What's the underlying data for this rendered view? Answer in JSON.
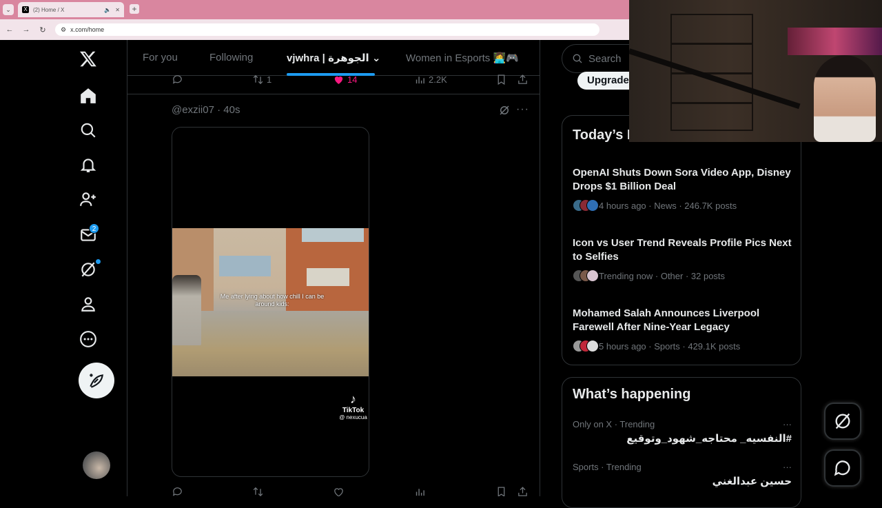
{
  "browser": {
    "tab_title": "(2) Home / X",
    "tab_favicon": "X",
    "url": "x.com/home"
  },
  "nav": {
    "messages_badge": "2"
  },
  "timeline": {
    "tabs": [
      "For you",
      "Following",
      "vjwhra | الجوهرة",
      "Women in Esports 👩‍💻🎮"
    ],
    "active_tab_index": 2,
    "prev_post": {
      "reposts": "1",
      "likes": "14",
      "views": "2.2K"
    },
    "post": {
      "handle": "@exzii07",
      "time": "40s",
      "caption": "Me after lying about how chill I can be around kids:",
      "tiktok_brand": "TikTok",
      "tiktok_handle": "@ nexucua"
    }
  },
  "sidebar": {
    "search_placeholder": "Search",
    "upgrade_label": "Upgrade",
    "todays_news": {
      "title": "Today’s News",
      "items": [
        {
          "title": "OpenAI Shuts Down Sora Video App, Disney Drops $1 Billion Deal",
          "meta": "4 hours ago · News · 246.7K posts"
        },
        {
          "title": "Icon vs User Trend Reveals Profile Pics Next to Selfies",
          "meta": "Trending now · Other · 32 posts"
        },
        {
          "title": "Mohamed Salah Announces Liverpool Farewell After Nine-Year Legacy",
          "meta": "5 hours ago · Sports · 429.1K posts"
        }
      ]
    },
    "whats_happening": {
      "title": "What’s happening",
      "trends": [
        {
          "meta": "Only on X · Trending",
          "text": "#النفسيه_ محتاجه_شهود_وتوقيع"
        },
        {
          "meta": "Sports · Trending",
          "text": "حسين عبدالغني"
        }
      ]
    }
  },
  "colors": {
    "accent": "#1d9bf0",
    "like": "#f91880",
    "tab_bar": "#d9869f"
  }
}
